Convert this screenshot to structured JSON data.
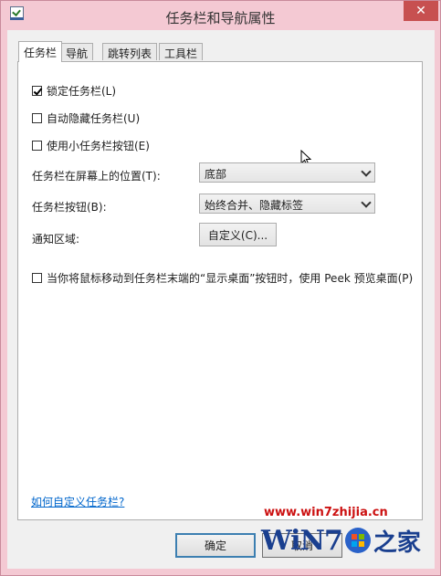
{
  "window": {
    "title": "任务栏和导航属性",
    "close_glyph": "✕"
  },
  "tabs": [
    {
      "label": "任务栏"
    },
    {
      "label": "导航"
    },
    {
      "label": "跳转列表"
    },
    {
      "label": "工具栏"
    }
  ],
  "options": {
    "lock_taskbar": {
      "label": "锁定任务栏(L)",
      "checked": true
    },
    "auto_hide": {
      "label": "自动隐藏任务栏(U)",
      "checked": false
    },
    "small_buttons": {
      "label": "使用小任务栏按钮(E)",
      "checked": false
    }
  },
  "location": {
    "label": "任务栏在屏幕上的位置(T):",
    "value": "底部"
  },
  "buttons_mode": {
    "label": "任务栏按钮(B):",
    "value": "始终合并、隐藏标签"
  },
  "notification_area": {
    "label": "通知区域:",
    "customize_label": "自定义(C)..."
  },
  "peek": {
    "label": "当你将鼠标移动到任务栏末端的“显示桌面”按钮时，使用 Peek 预览桌面(P)",
    "checked": false
  },
  "help_link": "如何自定义任务栏?",
  "footer": {
    "ok_label": "确定",
    "cancel_label": "取消"
  },
  "watermark": {
    "url": "www.win7zhijia.cn",
    "logo_text": "WiN7",
    "logo_suffix": "之家"
  }
}
